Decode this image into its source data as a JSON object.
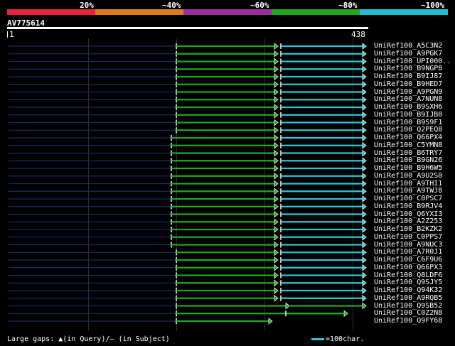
{
  "legend": {
    "segments": [
      {
        "label": "20%",
        "color": "#e8223a"
      },
      {
        "label": "~40%",
        "color": "#e07a1e"
      },
      {
        "label": "~60%",
        "color": "#9b2f9b"
      },
      {
        "label": "~80%",
        "color": "#1fa81f"
      },
      {
        "label": "~100%",
        "color": "#1fc0cc"
      }
    ]
  },
  "query": {
    "name": "AV775614",
    "start": "1",
    "end": "438"
  },
  "colors": {
    "green": "#1fa81f",
    "cyan": "#2cc6d4",
    "navy": "#1a2a6a",
    "grid": "#2e2e2e"
  },
  "hits": [
    "UniRef100_A5C3N2",
    "UniRef100_A9PGK7",
    "UniRef100_UPI000..",
    "UniRef100_B9NGP8",
    "UniRef100_B9IJ87",
    "UniRef100_B9HED7",
    "UniRef100_A9PGN9",
    "UniRef100_A7NUN8",
    "UniRef100_B9SXH6",
    "UniRef100_B9IJB0",
    "UniRef100_B9S9F1",
    "UniRef100_Q2PEQ8",
    "UniRef100_Q66PX4",
    "UniRef100_C5YMN8",
    "UniRef100_B6TRY7",
    "UniRef100_B9GN26",
    "UniRef100_B9H6W5",
    "UniRef100_A9U2S0",
    "UniRef100_A9THI1",
    "UniRef100_A9TWJ8",
    "UniRef100_C0PSC7",
    "UniRef100_B9RJV4",
    "UniRef100_Q6YXI3",
    "UniRef100_A2Z253",
    "UniRef100_B2KZK2",
    "UniRef100_C0PPS7",
    "UniRef100_A9NUC3",
    "UniRef100_A7R0J1",
    "UniRef100_C6F9U6",
    "UniRef100_Q66PX3",
    "UniRef100_Q8LDF6",
    "UniRef100_Q9SJY5",
    "UniRef100_Q94K32",
    "UniRef100_A9RQB5",
    "UniRef100_Q9SB52",
    "UniRef100_C0Z2N8",
    "UniRef100_Q9FY68"
  ],
  "footer": {
    "gaps_text": "Large gaps: ▲(in Query)/– (in Subject)",
    "scale_text": "=100char."
  }
}
